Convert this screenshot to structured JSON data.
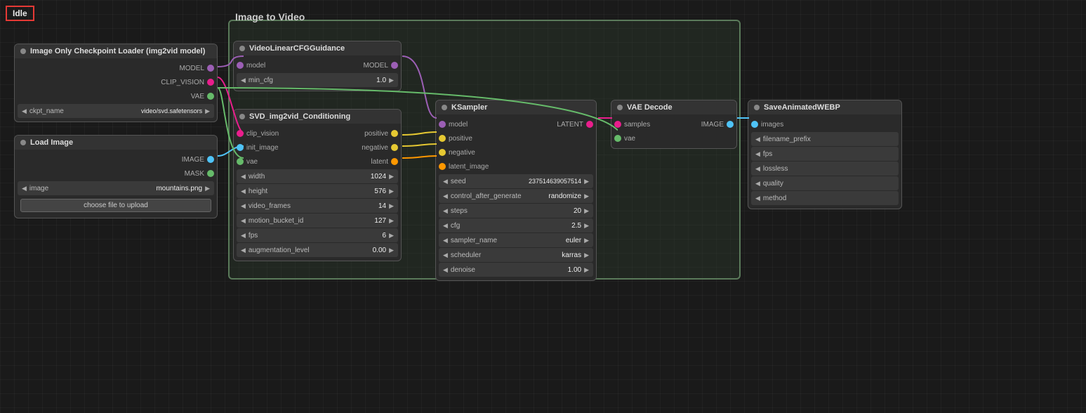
{
  "status": {
    "label": "Idle",
    "color": "#e53935"
  },
  "group": {
    "label": "Image to Video"
  },
  "nodes": {
    "checkpoint": {
      "title": "Image Only Checkpoint Loader (img2vid model)",
      "ports_out": [
        "MODEL",
        "CLIP_VISION",
        "VAE"
      ],
      "widget": {
        "label": "ckpt_name",
        "value": "video/svd.safetensors"
      }
    },
    "load_image": {
      "title": "Load Image",
      "ports_out": [
        "IMAGE",
        "MASK"
      ],
      "widget_image": {
        "label": "image",
        "value": "mountains.png"
      },
      "choose_btn": "choose file to upload"
    },
    "video_cfg": {
      "title": "VideoLinearCFGGuidance",
      "port_in": "model",
      "port_out": "MODEL",
      "widget": {
        "label": "min_cfg",
        "value": "1.0"
      }
    },
    "svd_conditioning": {
      "title": "SVD_img2vid_Conditioning",
      "ports_in": [
        "clip_vision",
        "init_image",
        "vae"
      ],
      "ports_out": [
        "positive",
        "negative",
        "latent"
      ],
      "widgets": [
        {
          "label": "width",
          "value": "1024"
        },
        {
          "label": "height",
          "value": "576"
        },
        {
          "label": "video_frames",
          "value": "14"
        },
        {
          "label": "motion_bucket_id",
          "value": "127"
        },
        {
          "label": "fps",
          "value": "6"
        },
        {
          "label": "augmentation_level",
          "value": "0.00"
        }
      ]
    },
    "ksampler": {
      "title": "KSampler",
      "ports_in": [
        "model",
        "positive",
        "negative",
        "latent_image"
      ],
      "port_out": "LATENT",
      "widgets": [
        {
          "label": "seed",
          "value": "237514639057514"
        },
        {
          "label": "control_after_generate",
          "value": "randomize"
        },
        {
          "label": "steps",
          "value": "20"
        },
        {
          "label": "cfg",
          "value": "2.5"
        },
        {
          "label": "sampler_name",
          "value": "euler"
        },
        {
          "label": "scheduler",
          "value": "karras"
        },
        {
          "label": "denoise",
          "value": "1.00"
        }
      ]
    },
    "vae_decode": {
      "title": "VAE Decode",
      "ports_in": [
        "samples",
        "vae"
      ],
      "port_out": "IMAGE"
    },
    "save_webp": {
      "title": "SaveAnimatedWEBP",
      "port_in": "images",
      "widgets": [
        {
          "label": "filename_prefix",
          "value": ""
        },
        {
          "label": "fps",
          "value": ""
        },
        {
          "label": "lossless",
          "value": ""
        },
        {
          "label": "quality",
          "value": ""
        },
        {
          "label": "method",
          "value": ""
        }
      ]
    }
  }
}
